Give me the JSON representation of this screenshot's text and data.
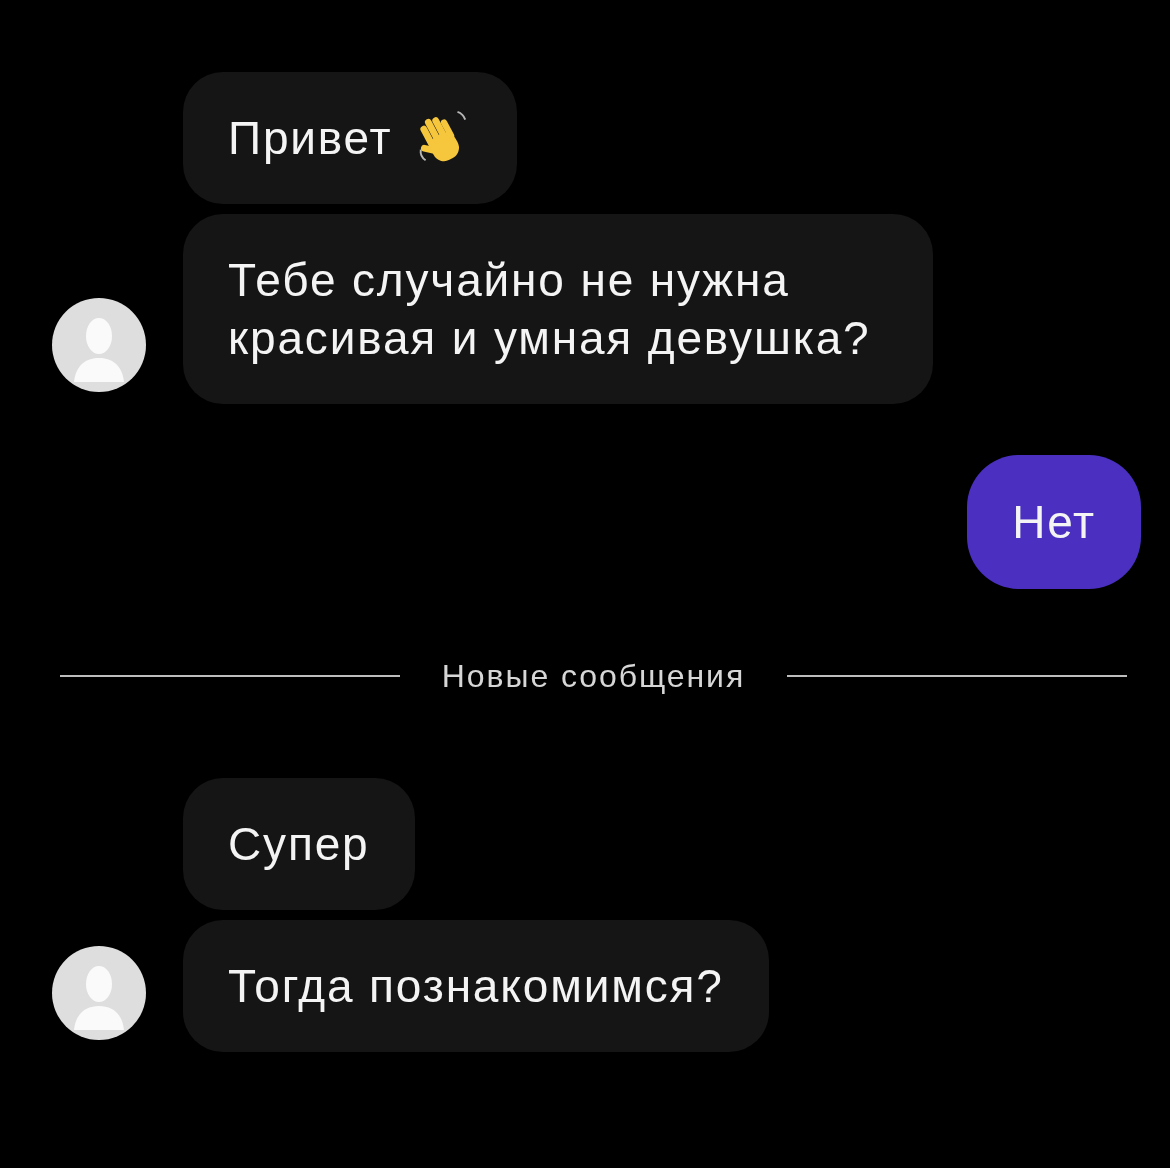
{
  "chat": [
    {
      "kind": "incoming",
      "messages": [
        {
          "text": "Привет",
          "has_emoji": true
        },
        {
          "text": "Тебе случайно не нужна красивая и умная девушка?"
        }
      ]
    },
    {
      "kind": "outgoing",
      "messages": [
        {
          "text": "Нет"
        }
      ]
    },
    {
      "kind": "divider",
      "label": "Новые сообщения"
    },
    {
      "kind": "incoming",
      "messages": [
        {
          "text": "Супер"
        },
        {
          "text": "Тогда познакомимся?"
        }
      ]
    }
  ]
}
